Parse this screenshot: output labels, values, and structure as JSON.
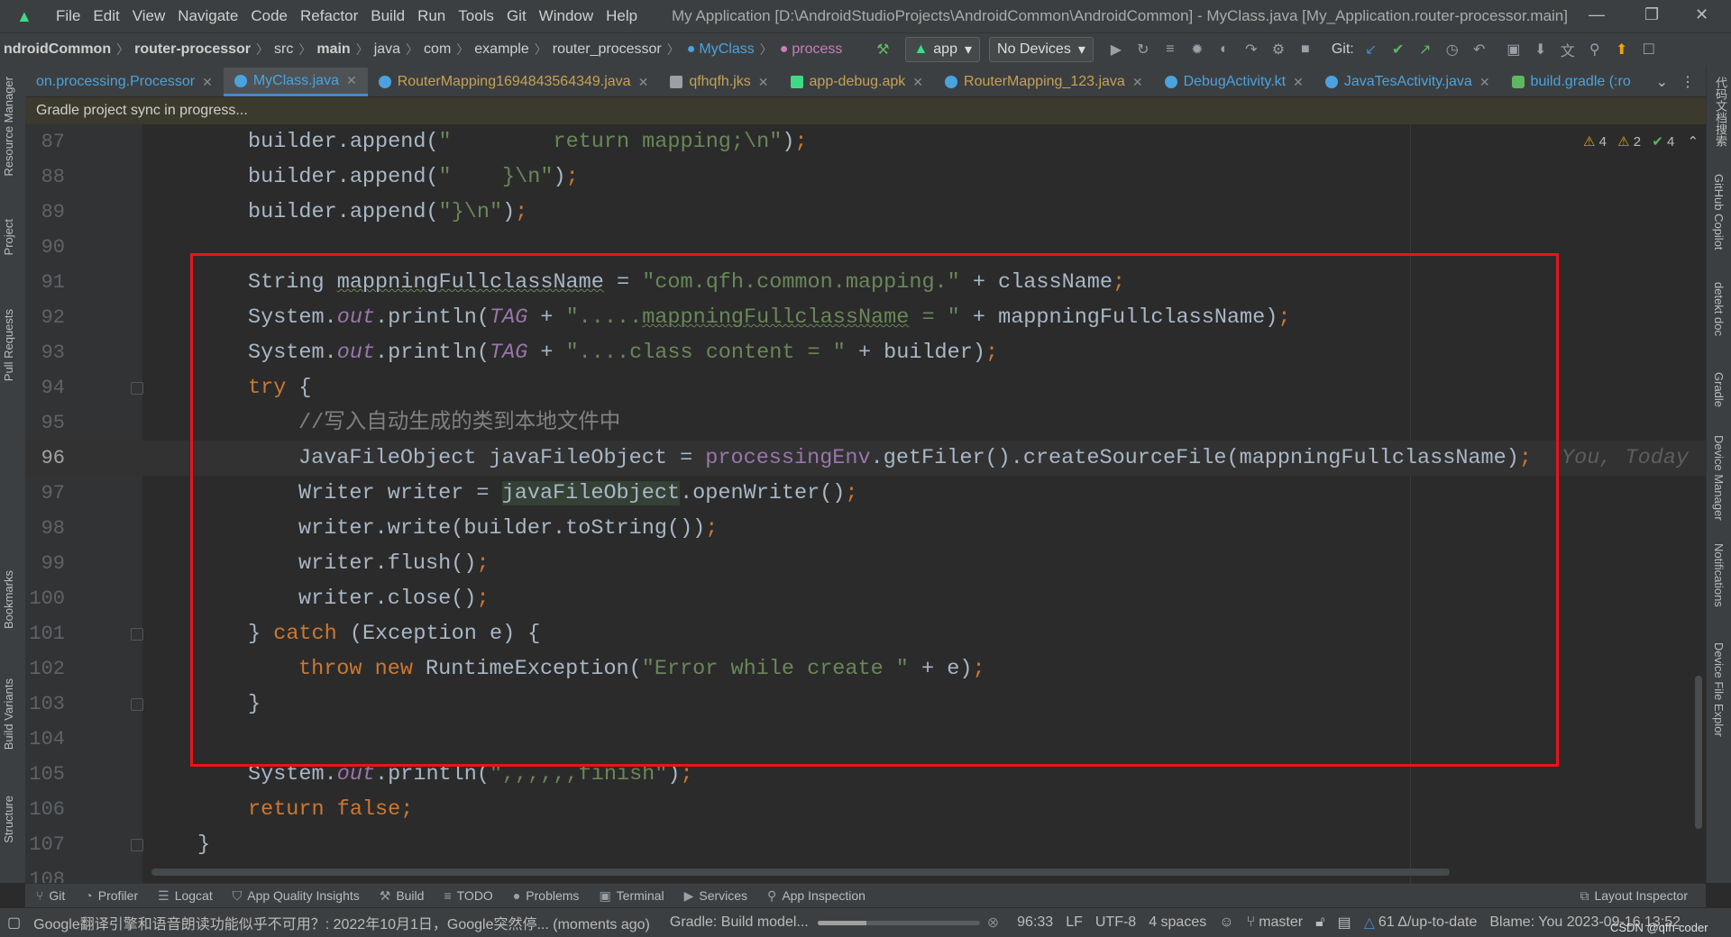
{
  "menu": {
    "items": [
      "File",
      "Edit",
      "View",
      "Navigate",
      "Code",
      "Refactor",
      "Build",
      "Run",
      "Tools",
      "Git",
      "Window",
      "Help"
    ],
    "title": "My Application [D:\\AndroidStudioProjects\\AndroidCommon\\AndroidCommon] - MyClass.java [My_Application.router-processor.main]"
  },
  "breadcrumb": {
    "items": [
      "ndroidCommon",
      "router-processor",
      "src",
      "main",
      "java",
      "com",
      "example",
      "router_processor",
      "MyClass",
      "process"
    ],
    "run_config": "app",
    "devices": "No Devices",
    "git_label": "Git:"
  },
  "tabs": [
    {
      "label": "on.processing.Processor",
      "active": false
    },
    {
      "label": "MyClass.java",
      "active": true
    },
    {
      "label": "RouterMapping1694843564349.java",
      "active": false
    },
    {
      "label": "qfhqfh.jks",
      "active": false
    },
    {
      "label": "app-debug.apk",
      "active": false
    },
    {
      "label": "RouterMapping_123.java",
      "active": false
    },
    {
      "label": "DebugActivity.kt",
      "active": false
    },
    {
      "label": "JavaTesActivity.java",
      "active": false
    },
    {
      "label": "build.gradle (:ro",
      "active": false
    }
  ],
  "banner": "Gradle project sync in progress...",
  "left_tools": [
    "Resource Manager",
    "Project",
    "Pull Requests",
    "Bookmarks",
    "Build Variants",
    "Structure"
  ],
  "right_tools": [
    "代码文档搜索",
    "GitHub Copilot",
    "detekt doc",
    "Gradle",
    "Device Manager",
    "Notifications",
    "Device File Explor"
  ],
  "inspections": {
    "warn1": "4",
    "warn2": "2",
    "ok": "4"
  },
  "editor": {
    "current_line": "96",
    "blame_inline": "You, Today",
    "lines": [
      {
        "n": "87"
      },
      {
        "n": "88"
      },
      {
        "n": "89"
      },
      {
        "n": "90"
      },
      {
        "n": "91"
      },
      {
        "n": "92"
      },
      {
        "n": "93"
      },
      {
        "n": "94"
      },
      {
        "n": "95"
      },
      {
        "n": "96"
      },
      {
        "n": "97"
      },
      {
        "n": "98"
      },
      {
        "n": "99"
      },
      {
        "n": "100"
      },
      {
        "n": "101"
      },
      {
        "n": "102"
      },
      {
        "n": "103"
      },
      {
        "n": "104"
      },
      {
        "n": "105"
      },
      {
        "n": "106"
      },
      {
        "n": "107"
      },
      {
        "n": "108"
      }
    ]
  },
  "bottom_tabs": [
    "Git",
    "Profiler",
    "Logcat",
    "App Quality Insights",
    "Build",
    "TODO",
    "Problems",
    "Terminal",
    "Services",
    "App Inspection",
    "Layout Inspector"
  ],
  "status": {
    "message": "Google翻译引擎和语音朗读功能似乎不可用？: 2022年10月1日，Google突然停... (moments ago)",
    "gradle": "Gradle: Build model...",
    "position": "96:33",
    "line_sep": "LF",
    "encoding": "UTF-8",
    "indent": "4 spaces",
    "branch": "master",
    "updates": "61 Δ/up-to-date",
    "blame": "Blame: You 2023-09-16 13:52",
    "watermark": "CSDN @qfh-coder"
  },
  "colors": {
    "accent": "#4a88c7",
    "highlight_box": "#e8141c",
    "keyword": "#cc7832",
    "string": "#6a8759"
  }
}
